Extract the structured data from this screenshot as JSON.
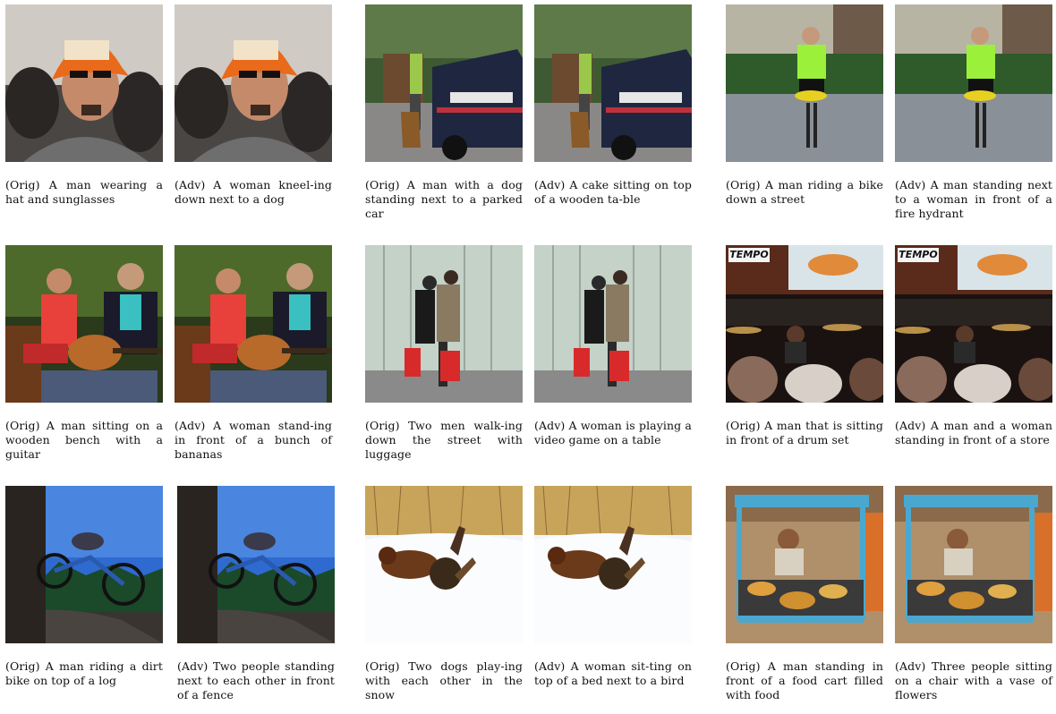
{
  "rows": [
    {
      "pairs": [
        {
          "orig": {
            "caption": "(Orig) A man wearing a hat and sunglasses",
            "scene": "man-hat"
          },
          "adv": {
            "caption": "(Adv) A woman kneel-ing down next to a dog",
            "scene": "man-hat"
          }
        },
        {
          "orig": {
            "caption": "(Orig) A man with a dog standing next to a parked car",
            "scene": "police-car"
          },
          "adv": {
            "caption": "(Adv) A cake sitting on top of a wooden ta-ble",
            "scene": "police-car"
          }
        },
        {
          "orig": {
            "caption": "(Orig) A man riding a bike down a street",
            "scene": "cyclist"
          },
          "adv": {
            "caption": "(Adv) A man standing next to a woman in front of a fire hydrant",
            "scene": "cyclist"
          }
        }
      ]
    },
    {
      "pairs": [
        {
          "orig": {
            "caption": "(Orig) A man sitting on a wooden bench with a guitar",
            "scene": "guitar"
          },
          "adv": {
            "caption": "(Adv) A woman stand-ing in front of a bunch of bananas",
            "scene": "guitar"
          }
        },
        {
          "orig": {
            "caption": "(Orig) Two men walk-ing down the street with luggage",
            "scene": "two-men"
          },
          "adv": {
            "caption": "(Adv) A woman is playing a video game on a table",
            "scene": "two-men"
          }
        },
        {
          "orig": {
            "caption": "(Orig) A man that is sitting in front of a drum set",
            "scene": "drums",
            "sign": "TEMPO"
          },
          "adv": {
            "caption": "(Adv) A man and a woman standing in front of a store",
            "scene": "drums",
            "sign": "TEMPO"
          }
        }
      ]
    },
    {
      "pairs": [
        {
          "orig": {
            "caption": "(Orig) A man riding a dirt bike on top of a log",
            "scene": "dirt-bike"
          },
          "adv": {
            "caption": "(Adv) Two people standing next to each other in front of a fence",
            "scene": "dirt-bike"
          }
        },
        {
          "orig": {
            "caption": "(Orig) Two dogs play-ing with each other in the snow",
            "scene": "dogs-snow"
          },
          "adv": {
            "caption": "(Adv) A woman sit-ting on top of a bed next to a bird",
            "scene": "dogs-snow"
          }
        },
        {
          "orig": {
            "caption": "(Orig) A man standing in front of a food cart filled with food",
            "scene": "food-cart"
          },
          "adv": {
            "caption": "(Adv) Three people sitting on a chair with a vase of flowers",
            "scene": "food-cart"
          }
        }
      ]
    }
  ]
}
